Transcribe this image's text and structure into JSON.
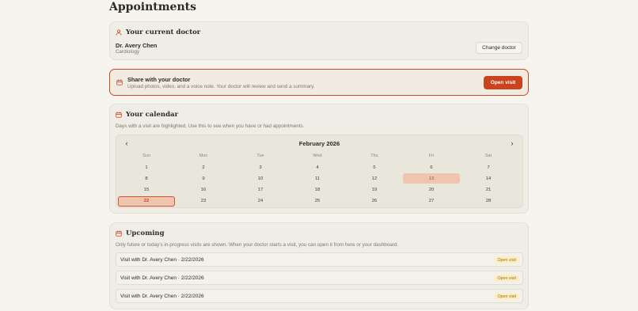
{
  "page": {
    "title": "Appointments"
  },
  "doctor_card": {
    "heading": "Your current doctor",
    "icon": "user-icon",
    "name": "Dr. Avery Chen",
    "specialty": "Cardiology",
    "change_label": "Change doctor"
  },
  "share_card": {
    "icon": "calendar-icon",
    "title": "Share with your doctor",
    "subtitle": "Upload photos, video, and a voice note. Your doctor will review and send a summary.",
    "button_label": "Open visit"
  },
  "calendar": {
    "heading": "Your calendar",
    "icon": "calendar-icon",
    "description": "Days with a visit are highlighted. Use this to see when you have or had appointments.",
    "month_label": "February 2026",
    "prev_glyph": "‹",
    "next_glyph": "›",
    "weekdays": [
      "Sun",
      "Mon",
      "Tue",
      "Wed",
      "Thu",
      "Fri",
      "Sat"
    ],
    "weeks": [
      [
        "1",
        "2",
        "3",
        "4",
        "5",
        "6",
        "7"
      ],
      [
        "8",
        "9",
        "10",
        "11",
        "12",
        "13",
        "14"
      ],
      [
        "15",
        "16",
        "17",
        "18",
        "19",
        "20",
        "21"
      ],
      [
        "22",
        "23",
        "24",
        "25",
        "26",
        "27",
        "28"
      ]
    ],
    "highlighted_days": [
      "13"
    ],
    "selected_day": "22",
    "colors": {
      "highlight_bg": "#f0c5b0",
      "highlight_text": "#c43f1c",
      "accent": "#c9441d"
    }
  },
  "upcoming": {
    "heading": "Upcoming",
    "icon": "calendar-icon",
    "description": "Only future or today's in-progress visits are shown. When your doctor starts a visit, you can open it from here or your dashboard.",
    "visits": [
      {
        "title": "Visit with Dr. Avery Chen · 2/22/2026",
        "action": "Open visit"
      },
      {
        "title": "Visit with Dr. Avery Chen · 2/22/2026",
        "action": "Open visit"
      },
      {
        "title": "Visit with Dr. Avery Chen · 2/22/2026",
        "action": "Open visit"
      }
    ]
  }
}
